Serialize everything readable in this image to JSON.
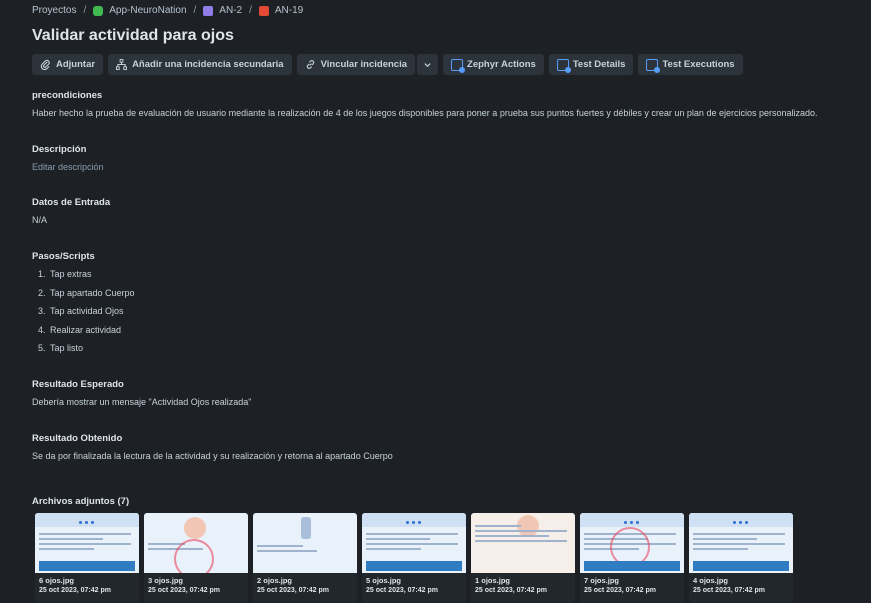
{
  "breadcrumb": {
    "items": [
      {
        "label": "Proyectos",
        "icon": ""
      },
      {
        "label": "App-NeuroNation",
        "icon": "app-icon"
      },
      {
        "label": "AN-2",
        "icon": "epic-icon"
      },
      {
        "label": "AN-19",
        "icon": "bug-icon"
      }
    ]
  },
  "issue": {
    "title": "Validar actividad para ojos"
  },
  "toolbar": {
    "attach": "Adjuntar",
    "child": "Añadir una incidencia secundaria",
    "link": "Vincular incidencia",
    "zephyr": "Zephyr Actions",
    "details": "Test Details",
    "executions": "Test Executions"
  },
  "preconditions": {
    "label": "precondiciones",
    "text": "Haber hecho la prueba de evaluación de usuario mediante la realización de 4 de los juegos disponibles para poner a prueba sus puntos fuertes y débiles y crear un plan de ejercicios personalizado."
  },
  "description": {
    "label": "Descripción",
    "placeholder": "Editar descripción"
  },
  "input_data": {
    "label": "Datos de Entrada",
    "value": "N/A"
  },
  "steps": {
    "label": "Pasos/Scripts",
    "items": [
      "Tap extras",
      "Tap apartado Cuerpo",
      "Tap actividad Ojos",
      "Realizar actividad",
      "Tap listo"
    ]
  },
  "expected": {
    "label": "Resultado Esperado",
    "text": "Debería mostrar un mensaje \"Actividad Ojos realizada\""
  },
  "obtained": {
    "label": "Resultado Obtenido",
    "text": "Se da por finalizada la lectura de la actividad y su realización y retorna al apartado Cuerpo"
  },
  "attachments": {
    "label": "Archivos adjuntos (7)",
    "files": [
      {
        "name": "6 ojos.jpg",
        "date": "25 oct 2023, 07:42 pm"
      },
      {
        "name": "3 ojos.jpg",
        "date": "25 oct 2023, 07:42 pm"
      },
      {
        "name": "2 ojos.jpg",
        "date": "25 oct 2023, 07:42 pm"
      },
      {
        "name": "5 ojos.jpg",
        "date": "25 oct 2023, 07:42 pm"
      },
      {
        "name": "1 ojos.jpg",
        "date": "25 oct 2023, 07:42 pm"
      },
      {
        "name": "7 ojos.jpg",
        "date": "25 oct 2023, 07:42 pm"
      },
      {
        "name": "4 ojos.jpg",
        "date": "25 oct 2023, 07:42 pm"
      }
    ]
  }
}
